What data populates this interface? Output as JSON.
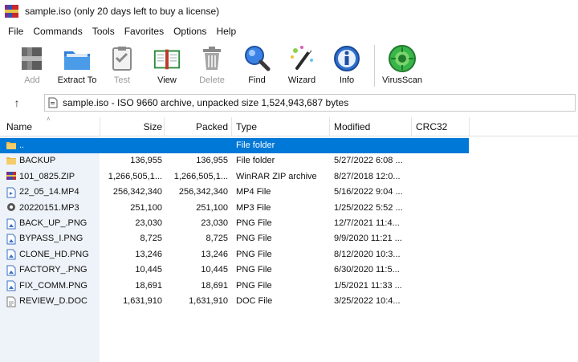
{
  "window": {
    "title": "sample.iso (only 20 days left to buy a license)"
  },
  "menu": [
    "File",
    "Commands",
    "Tools",
    "Favorites",
    "Options",
    "Help"
  ],
  "toolbar": [
    {
      "label": "Add",
      "icon": "add-icon",
      "disabled": true
    },
    {
      "label": "Extract To",
      "icon": "extract-to-icon",
      "disabled": false
    },
    {
      "label": "Test",
      "icon": "test-icon",
      "disabled": true
    },
    {
      "label": "View",
      "icon": "view-icon",
      "disabled": false
    },
    {
      "label": "Delete",
      "icon": "delete-icon",
      "disabled": true
    },
    {
      "label": "Find",
      "icon": "find-icon",
      "disabled": false
    },
    {
      "label": "Wizard",
      "icon": "wizard-icon",
      "disabled": false
    },
    {
      "label": "Info",
      "icon": "info-icon",
      "disabled": false
    },
    {
      "label": "VirusScan",
      "icon": "virusscan-icon",
      "disabled": false
    }
  ],
  "address": {
    "text": "sample.iso - ISO 9660 archive, unpacked size 1,524,943,687 bytes"
  },
  "columns": {
    "name": "Name",
    "size": "Size",
    "packed": "Packed",
    "type": "Type",
    "modified": "Modified",
    "crc": "CRC32"
  },
  "files": [
    {
      "name": "..",
      "size": "",
      "packed": "",
      "type": "File folder",
      "modified": "",
      "icon": "folder-icon",
      "selected": true
    },
    {
      "name": "BACKUP",
      "size": "136,955",
      "packed": "136,955",
      "type": "File folder",
      "modified": "5/27/2022 6:08 ...",
      "icon": "folder-icon",
      "selected": false
    },
    {
      "name": "101_0825.ZIP",
      "size": "1,266,505,1...",
      "packed": "1,266,505,1...",
      "type": "WinRAR ZIP archive",
      "modified": "8/27/2018 12:0...",
      "icon": "zip-icon",
      "selected": false
    },
    {
      "name": "22_05_14.MP4",
      "size": "256,342,340",
      "packed": "256,342,340",
      "type": "MP4 File",
      "modified": "5/16/2022 9:04 ...",
      "icon": "video-icon",
      "selected": false
    },
    {
      "name": "20220151.MP3",
      "size": "251,100",
      "packed": "251,100",
      "type": "MP3 File",
      "modified": "1/25/2022 5:52 ...",
      "icon": "audio-icon",
      "selected": false
    },
    {
      "name": "BACK_UP_.PNG",
      "size": "23,030",
      "packed": "23,030",
      "type": "PNG File",
      "modified": "12/7/2021 11:4...",
      "icon": "image-icon",
      "selected": false
    },
    {
      "name": "BYPASS_I.PNG",
      "size": "8,725",
      "packed": "8,725",
      "type": "PNG File",
      "modified": "9/9/2020 11:21 ...",
      "icon": "image-icon",
      "selected": false
    },
    {
      "name": "CLONE_HD.PNG",
      "size": "13,246",
      "packed": "13,246",
      "type": "PNG File",
      "modified": "8/12/2020 10:3...",
      "icon": "image-icon",
      "selected": false
    },
    {
      "name": "FACTORY_.PNG",
      "size": "10,445",
      "packed": "10,445",
      "type": "PNG File",
      "modified": "6/30/2020 11:5...",
      "icon": "image-icon",
      "selected": false
    },
    {
      "name": "FIX_COMM.PNG",
      "size": "18,691",
      "packed": "18,691",
      "type": "PNG File",
      "modified": "1/5/2021 11:33 ...",
      "icon": "image-icon",
      "selected": false
    },
    {
      "name": "REVIEW_D.DOC",
      "size": "1,631,910",
      "packed": "1,631,910",
      "type": "DOC File",
      "modified": "3/25/2022 10:4...",
      "icon": "document-icon",
      "selected": false
    }
  ],
  "colors": {
    "selection": "#0078d7",
    "folder": "#e8b84a",
    "sidebar": "#eef3f9"
  }
}
